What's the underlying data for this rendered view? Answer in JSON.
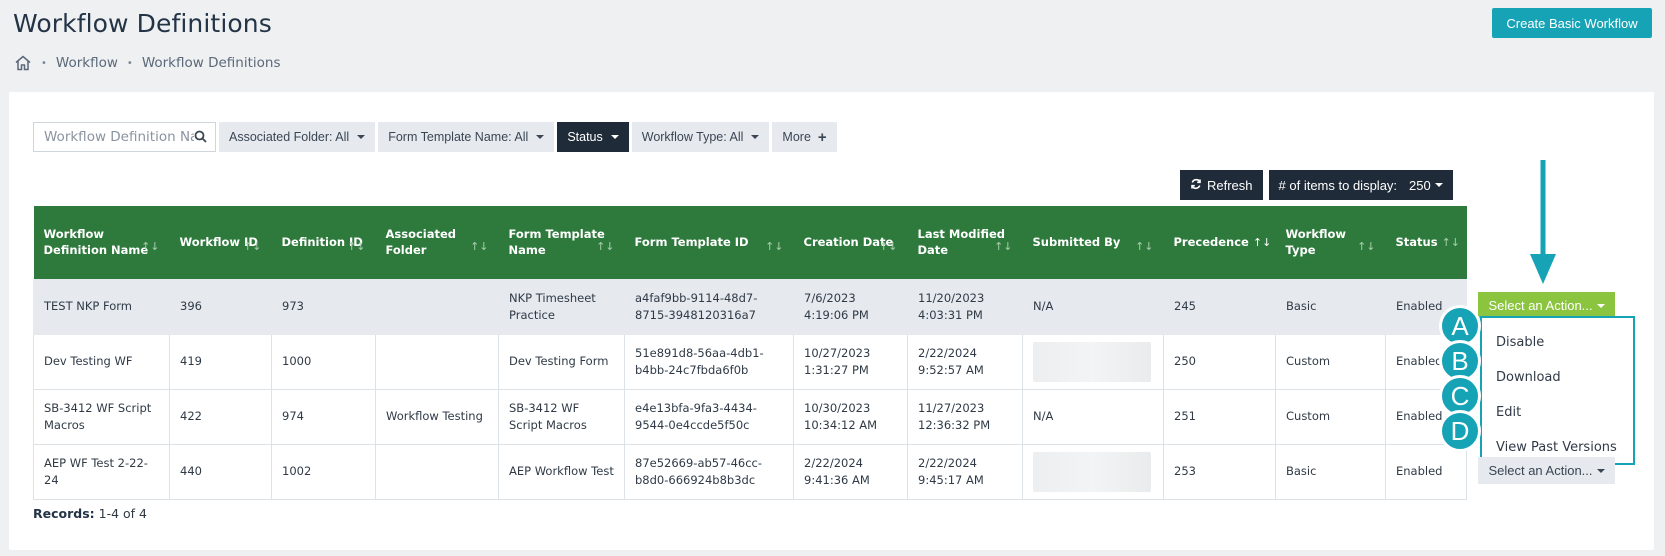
{
  "header": {
    "title": "Workflow Definitions",
    "create_button": "Create Basic Workflow"
  },
  "breadcrumb": {
    "home_icon": "home-icon",
    "items": [
      "Workflow",
      "Workflow Definitions"
    ],
    "separator": "•"
  },
  "filters": {
    "search_placeholder": "Workflow Definition Name",
    "buttons": [
      {
        "label": "Associated Folder: All"
      },
      {
        "label": "Form Template Name: All"
      },
      {
        "label": "Status"
      },
      {
        "label": "Workflow Type: All"
      },
      {
        "label": "More"
      }
    ]
  },
  "toolbar": {
    "refresh_label": "Refresh",
    "items_label": "# of items to display:",
    "items_value": "250"
  },
  "table": {
    "columns": [
      "Workflow Definition Name",
      "Workflow ID",
      "Definition ID",
      "Associated Folder",
      "Form Template Name",
      "Form Template ID",
      "Creation Date",
      "Last Modified Date",
      "Submitted By",
      "Precedence",
      "Workflow Type",
      "Status"
    ],
    "rows": [
      [
        "TEST NKP Form",
        "396",
        "973",
        "",
        "NKP Timesheet Practice",
        "a4faf9bb-9114-48d7-8715-3948120316a7",
        "7/6/2023 4:19:06 PM",
        "11/20/2023 4:03:31 PM",
        "N/A",
        "245",
        "Basic",
        "Enabled"
      ],
      [
        "Dev Testing WF",
        "419",
        "1000",
        "",
        "Dev Testing Form",
        "51e891d8-56aa-4db1-b4bb-24c7fbda6f0b",
        "10/27/2023 1:31:27 PM",
        "2/22/2024 9:52:57 AM",
        "",
        "250",
        "Custom",
        "Enabled"
      ],
      [
        "SB-3412 WF Script Macros",
        "422",
        "974",
        "Workflow Testing",
        "SB-3412 WF Script Macros",
        "e4e13bfa-9fa3-4434-9544-0e4ccde5f50c",
        "10/30/2023 10:34:12 AM",
        "11/27/2023 12:36:32 PM",
        "N/A",
        "251",
        "Custom",
        "Enabled"
      ],
      [
        "AEP WF Test 2-22-24",
        "440",
        "1002",
        "",
        "AEP Workflow Test",
        "87e52669-ab57-46cc-b8d0-666924b8b3dc",
        "2/22/2024 9:41:36 AM",
        "2/22/2024 9:45:17 AM",
        "",
        "253",
        "Basic",
        "Enabled"
      ]
    ]
  },
  "actions": {
    "select_label": "Select an Action...",
    "menu": [
      "Disable",
      "Download",
      "Edit",
      "View Past Versions"
    ],
    "markers": [
      "A",
      "B",
      "C",
      "D"
    ]
  },
  "footer": {
    "records_label": "Records:",
    "records_value": "1-4 of 4"
  },
  "colors": {
    "accent": "#17a3b6",
    "table_header": "#2e7a3c",
    "action_green": "#8bc53f",
    "dark_button": "#1f2b38"
  }
}
